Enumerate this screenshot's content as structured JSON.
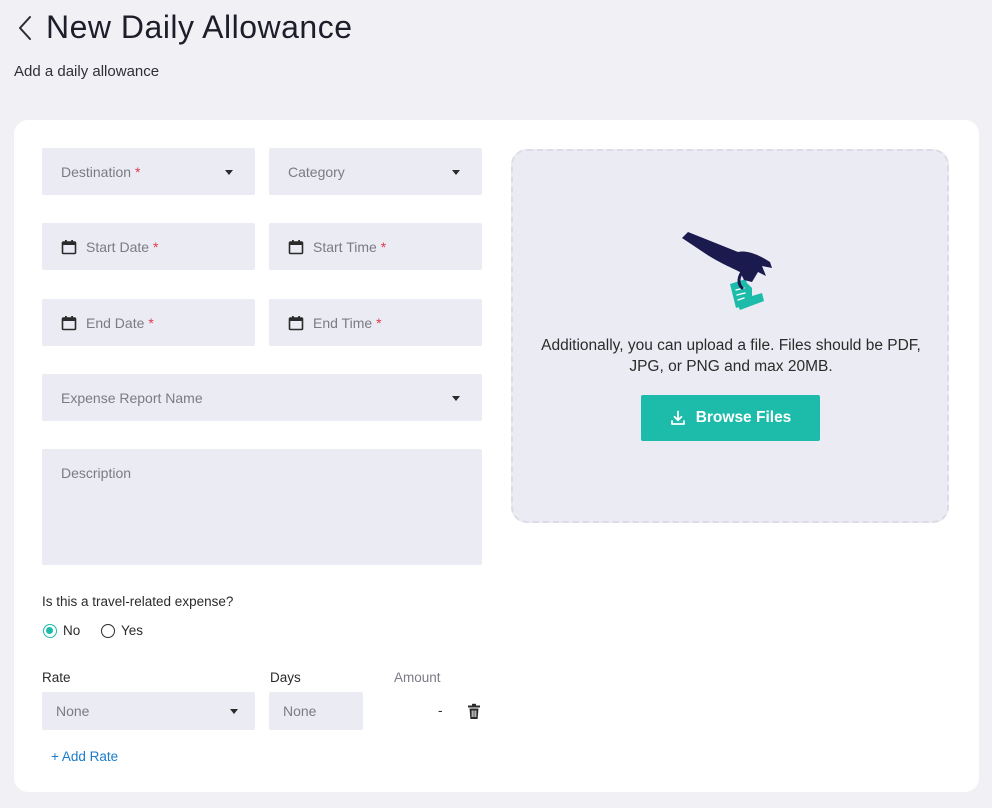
{
  "header": {
    "title": "New Daily Allowance",
    "subtitle": "Add a daily allowance"
  },
  "form": {
    "destination": {
      "placeholder": "Destination",
      "required_mark": "*"
    },
    "category": {
      "placeholder": "Category"
    },
    "start_date": {
      "placeholder": "Start Date",
      "required_mark": "*"
    },
    "start_time": {
      "placeholder": "Start Time",
      "required_mark": "*"
    },
    "end_date": {
      "placeholder": "End Date",
      "required_mark": "*"
    },
    "end_time": {
      "placeholder": "End Time",
      "required_mark": "*"
    },
    "expense_report": {
      "placeholder": "Expense Report Name"
    },
    "description": {
      "placeholder": "Description"
    },
    "travel_question": "Is this a travel-related expense?",
    "travel_options": [
      {
        "label": "No",
        "selected": true
      },
      {
        "label": "Yes",
        "selected": false
      }
    ],
    "rates": {
      "headers": {
        "rate": "Rate",
        "days": "Days",
        "amount": "Amount"
      },
      "rows": [
        {
          "rate": "None",
          "days": "None",
          "amount": "-"
        }
      ],
      "add_label": "+ Add Rate"
    }
  },
  "upload": {
    "text": "Additionally, you can upload a file. Files should be PDF, JPG, or PNG and max 20MB.",
    "button_label": "Browse Files"
  },
  "colors": {
    "accent": "#1dbbaa",
    "required": "#e53950",
    "link": "#1c7cc9",
    "field_bg": "#ebebf3",
    "page_bg": "#f0f0f5",
    "illustration_hand": "#1b1a4f"
  }
}
